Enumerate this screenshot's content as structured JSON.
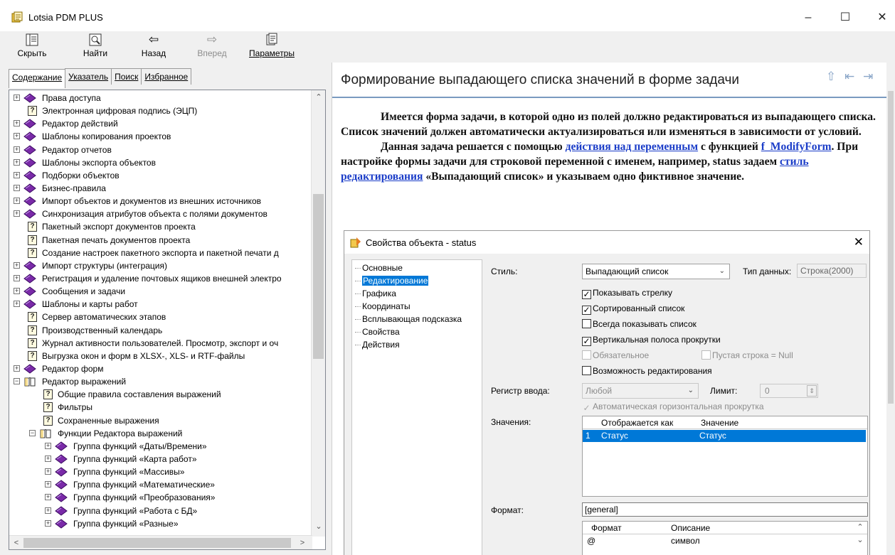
{
  "window": {
    "title": "Lotsia PDM PLUS",
    "minimize": "–",
    "maximize": "☐",
    "close": "✕"
  },
  "toolbar": {
    "hide": "Скрыть",
    "find": "Найти",
    "back": "Назад",
    "forward": "Вперед",
    "options": "Параметры"
  },
  "tabs": [
    "Содержание",
    "Указатель",
    "Поиск",
    "Избранное"
  ],
  "tree": [
    {
      "level": 0,
      "exp": "+",
      "icon": "book",
      "label": "Права доступа"
    },
    {
      "level": 0,
      "exp": "",
      "icon": "help",
      "label": "Электронная цифровая подпись (ЭЦП)"
    },
    {
      "level": 0,
      "exp": "+",
      "icon": "book",
      "label": "Редактор действий"
    },
    {
      "level": 0,
      "exp": "+",
      "icon": "book",
      "label": "Шаблоны копирования проектов"
    },
    {
      "level": 0,
      "exp": "+",
      "icon": "book",
      "label": "Редактор отчетов"
    },
    {
      "level": 0,
      "exp": "+",
      "icon": "book",
      "label": "Шаблоны экспорта объектов"
    },
    {
      "level": 0,
      "exp": "+",
      "icon": "book",
      "label": "Подборки объектов"
    },
    {
      "level": 0,
      "exp": "+",
      "icon": "book",
      "label": "Бизнес-правила"
    },
    {
      "level": 0,
      "exp": "+",
      "icon": "book",
      "label": "Импорт объектов и документов из внешних источников"
    },
    {
      "level": 0,
      "exp": "+",
      "icon": "book",
      "label": "Синхронизация атрибутов объекта с полями документов"
    },
    {
      "level": 0,
      "exp": "",
      "icon": "help",
      "label": "Пакетный экспорт документов проекта"
    },
    {
      "level": 0,
      "exp": "",
      "icon": "help",
      "label": "Пакетная печать документов проекта"
    },
    {
      "level": 0,
      "exp": "",
      "icon": "help",
      "label": "Создание настроек пакетного экспорта и пакетной печати д"
    },
    {
      "level": 0,
      "exp": "+",
      "icon": "book",
      "label": "Импорт структуры (интеграция)"
    },
    {
      "level": 0,
      "exp": "+",
      "icon": "book",
      "label": "Регистрация и удаление почтовых ящиков внешней электро"
    },
    {
      "level": 0,
      "exp": "+",
      "icon": "book",
      "label": "Сообщения и задачи"
    },
    {
      "level": 0,
      "exp": "+",
      "icon": "book",
      "label": "Шаблоны и карты работ"
    },
    {
      "level": 0,
      "exp": "",
      "icon": "help",
      "label": "Сервер автоматических этапов"
    },
    {
      "level": 0,
      "exp": "",
      "icon": "help",
      "label": "Производственный календарь"
    },
    {
      "level": 0,
      "exp": "",
      "icon": "help",
      "label": "Журнал активности пользователей. Просмотр, экспорт и оч"
    },
    {
      "level": 0,
      "exp": "",
      "icon": "help",
      "label": "Выгрузка окон и форм в XLSX-, XLS- и RTF-файлы"
    },
    {
      "level": 0,
      "exp": "+",
      "icon": "book",
      "label": "Редактор форм"
    },
    {
      "level": 0,
      "exp": "−",
      "icon": "open",
      "label": "Редактор выражений"
    },
    {
      "level": 1,
      "exp": "",
      "icon": "help",
      "label": "Общие правила составления выражений"
    },
    {
      "level": 1,
      "exp": "",
      "icon": "help",
      "label": "Фильтры"
    },
    {
      "level": 1,
      "exp": "",
      "icon": "help",
      "label": "Сохраненные выражения"
    },
    {
      "level": 1,
      "exp": "−",
      "icon": "open",
      "label": "Функции Редактора выражений"
    },
    {
      "level": 2,
      "exp": "+",
      "icon": "book",
      "label": "Группа функций «Даты/Времени»"
    },
    {
      "level": 2,
      "exp": "+",
      "icon": "book",
      "label": "Группа функций «Карта работ»"
    },
    {
      "level": 2,
      "exp": "+",
      "icon": "book",
      "label": "Группа функций «Массивы»"
    },
    {
      "level": 2,
      "exp": "+",
      "icon": "book",
      "label": "Группа функций «Математические»"
    },
    {
      "level": 2,
      "exp": "+",
      "icon": "book",
      "label": "Группа функций «Преобразования»"
    },
    {
      "level": 2,
      "exp": "+",
      "icon": "book",
      "label": "Группа функций «Работа с БД»"
    },
    {
      "level": 2,
      "exp": "+",
      "icon": "book",
      "label": "Группа функций «Разные»"
    }
  ],
  "topic": {
    "title": "Формирование выпадающего списка значений в форме задачи",
    "p1": "Имеется форма задачи, в которой одно из полей должно редактироваться из выпадающего списка. Список значений должен автоматически актуализироваться или изменяться в зависимости от условий.",
    "p2_a": "Данная задача решается с помощью ",
    "p2_link1": "действия над переменным",
    "p2_b": " с функцией ",
    "p2_link2": "f_ModifyForm",
    "p2_c": ". При настройке формы задачи для строковой переменной с именем, например, status задаем ",
    "p2_link3": "стиль редактирования",
    "p2_d": " «Выпадающий список» и указываем одно фиктивное значение."
  },
  "dialog": {
    "title": "Свойства объекта - status",
    "nav": [
      "Основные",
      "Редактирование",
      "Графика",
      "Координаты",
      "Всплывающая подсказка",
      "Свойства",
      "Действия"
    ],
    "style_label": "Стиль:",
    "style_value": "Выпадающий список",
    "datatype_label": "Тип данных:",
    "datatype_value": "Строка(2000)",
    "checks": {
      "show_arrow": "Показывать стрелку",
      "sorted": "Сортированный список",
      "always_show": "Всегда показывать список",
      "vscroll": "Вертикальная полоса прокрутки",
      "required": "Обязательное",
      "empty_null": "Пустая строка = Null",
      "editable": "Возможность редактирования",
      "auto_hscroll": "Автоматическая горизонтальная прокрутка"
    },
    "case_label": "Регистр ввода:",
    "case_value": "Любой",
    "limit_label": "Лимит:",
    "limit_value": "0",
    "values_label": "Значения:",
    "values_cols": [
      "Отображается как",
      "Значение"
    ],
    "values_row": {
      "n": "1",
      "display": "Статус",
      "value": "Статус"
    },
    "format_label": "Формат:",
    "format_value": "[general]",
    "format_cols": [
      "Формат",
      "Описание"
    ],
    "format_row": {
      "fmt": "@",
      "desc": "символ"
    }
  },
  "colors": {
    "book": "#7a2aa8",
    "selection": "#0078d7",
    "link": "#1a3cc8"
  }
}
